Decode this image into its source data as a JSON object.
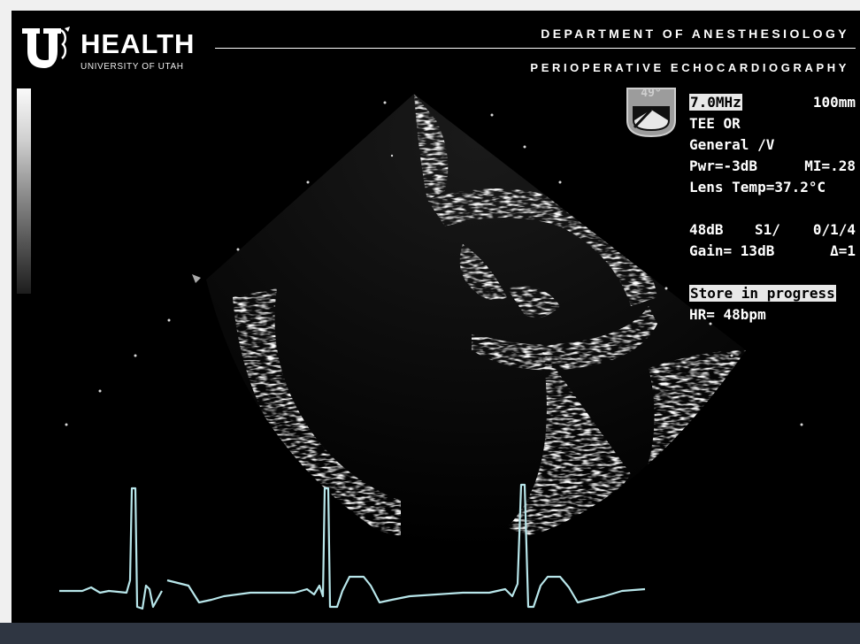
{
  "header": {
    "logo_word": "HEALTH",
    "logo_subtext": "UNIVERSITY OF UTAH",
    "department": "DEPARTMENT OF ANESTHESIOLOGY",
    "division": "PERIOPERATIVE ECHOCARDIOGRAPHY"
  },
  "probe": {
    "angle": "49°"
  },
  "info": {
    "frequency": "7.0MHz",
    "depth": "100mm",
    "preset": "TEE OR",
    "mode": "General /V",
    "power": "Pwr=-3dB",
    "mi": "MI=.28",
    "lens_temp": "Lens Temp=37.2°C",
    "dynamic_range": "48dB",
    "setting_s1": "S1/",
    "setting_code": "0/1/4",
    "gain": "Gain= 13dB",
    "delta": "Δ=1",
    "status": "Store in progress",
    "heart_rate": "HR= 48bpm"
  },
  "colors": {
    "ecg_trace": "#b8e6ea",
    "background": "#000000",
    "bottom_bar": "#2f3642"
  }
}
